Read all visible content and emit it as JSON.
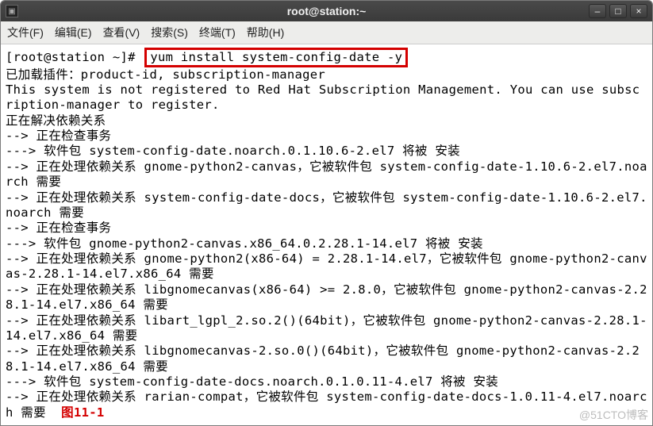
{
  "window": {
    "title": "root@station:~",
    "minimize": "–",
    "maximize": "□",
    "close": "×"
  },
  "menubar": {
    "file": "文件(F)",
    "edit": "编辑(E)",
    "view": "查看(V)",
    "search": "搜索(S)",
    "terminal": "终端(T)",
    "help": "帮助(H)"
  },
  "terminal": {
    "prompt": "[root@station ~]#",
    "command": "yum install system-config-date -y",
    "lines": [
      "已加载插件：product-id, subscription-manager",
      "This system is not registered to Red Hat Subscription Management. You can use subscription-manager to register.",
      "正在解决依赖关系",
      "--> 正在检查事务",
      "---> 软件包 system-config-date.noarch.0.1.10.6-2.el7 将被 安装",
      "--> 正在处理依赖关系 gnome-python2-canvas，它被软件包 system-config-date-1.10.6-2.el7.noarch 需要",
      "--> 正在处理依赖关系 system-config-date-docs，它被软件包 system-config-date-1.10.6-2.el7.noarch 需要",
      "--> 正在检查事务",
      "---> 软件包 gnome-python2-canvas.x86_64.0.2.28.1-14.el7 将被 安装",
      "--> 正在处理依赖关系 gnome-python2(x86-64) = 2.28.1-14.el7，它被软件包 gnome-python2-canvas-2.28.1-14.el7.x86_64 需要",
      "--> 正在处理依赖关系 libgnomecanvas(x86-64) >= 2.8.0，它被软件包 gnome-python2-canvas-2.28.1-14.el7.x86_64 需要",
      "--> 正在处理依赖关系 libart_lgpl_2.so.2()(64bit)，它被软件包 gnome-python2-canvas-2.28.1-14.el7.x86_64 需要",
      "--> 正在处理依赖关系 libgnomecanvas-2.so.0()(64bit)，它被软件包 gnome-python2-canvas-2.28.1-14.el7.x86_64 需要",
      "---> 软件包 system-config-date-docs.noarch.0.1.0.11-4.el7 将被 安装"
    ],
    "last_line_prefix": "--> 正在处理依赖关系 rarian-compat，它被软件包 system-config-date-docs-1.0.11-4.el7.noarch 需要  ",
    "figure_label": "图11-1"
  },
  "watermark": "@51CTO博客"
}
